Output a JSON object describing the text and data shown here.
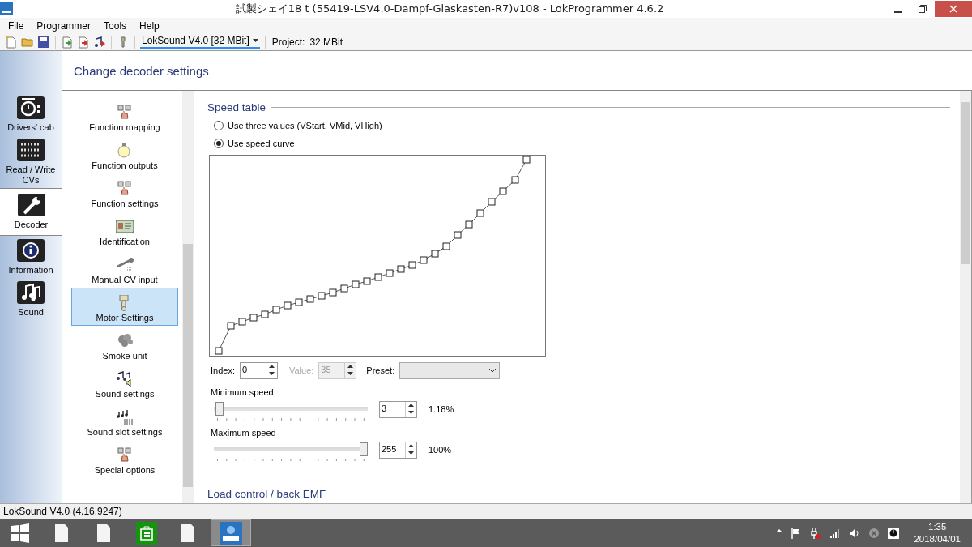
{
  "window": {
    "title": "試製シェイ18 t (55419-LSV4.0-Dampf-Glaskasten-R7)v108 - LokProgrammer 4.6.2"
  },
  "menu": [
    "File",
    "Programmer",
    "Tools",
    "Help"
  ],
  "toolbar": {
    "decoder": "LokSound V4.0 [32 MBit]",
    "project_label": "Project:",
    "project_value": "32 MBit"
  },
  "header": "Change decoder settings",
  "nav": [
    {
      "label": "Drivers' cab",
      "selected": false
    },
    {
      "label": "Read / Write CVs",
      "selected": false
    },
    {
      "label": "Decoder",
      "selected": true
    },
    {
      "label": "Information",
      "selected": false
    },
    {
      "label": "Sound",
      "selected": false
    }
  ],
  "settings_list": [
    {
      "label": "Function mapping",
      "selected": false
    },
    {
      "label": "Function outputs",
      "selected": false
    },
    {
      "label": "Function settings",
      "selected": false
    },
    {
      "label": "Identification",
      "selected": false
    },
    {
      "label": "Manual CV input",
      "selected": false
    },
    {
      "label": "Motor Settings",
      "selected": true
    },
    {
      "label": "Smoke unit",
      "selected": false
    },
    {
      "label": "Sound settings",
      "selected": false
    },
    {
      "label": "Sound slot settings",
      "selected": false
    },
    {
      "label": "Special options",
      "selected": false
    }
  ],
  "speed_table": {
    "title": "Speed table",
    "options": [
      {
        "label": "Use three values (VStart, VMid, VHigh)",
        "selected": false
      },
      {
        "label": "Use speed curve",
        "selected": true
      }
    ],
    "index": {
      "label": "Index:",
      "value": "0"
    },
    "value": {
      "label": "Value:",
      "value": "35",
      "disabled": true
    },
    "preset": {
      "label": "Preset:"
    },
    "sliders": [
      {
        "label": "Minimum speed",
        "level": 0.01,
        "value": "3",
        "percent": "1.18%"
      },
      {
        "label": "Maximum speed",
        "level": 1,
        "value": "255",
        "percent": "100%"
      }
    ]
  },
  "next_section": "Load control / back EMF",
  "status_bar": "LokSound V4.0 (4.16.9247)",
  "taskbar": {
    "time": "1:35",
    "date": "2018/04/01"
  }
}
